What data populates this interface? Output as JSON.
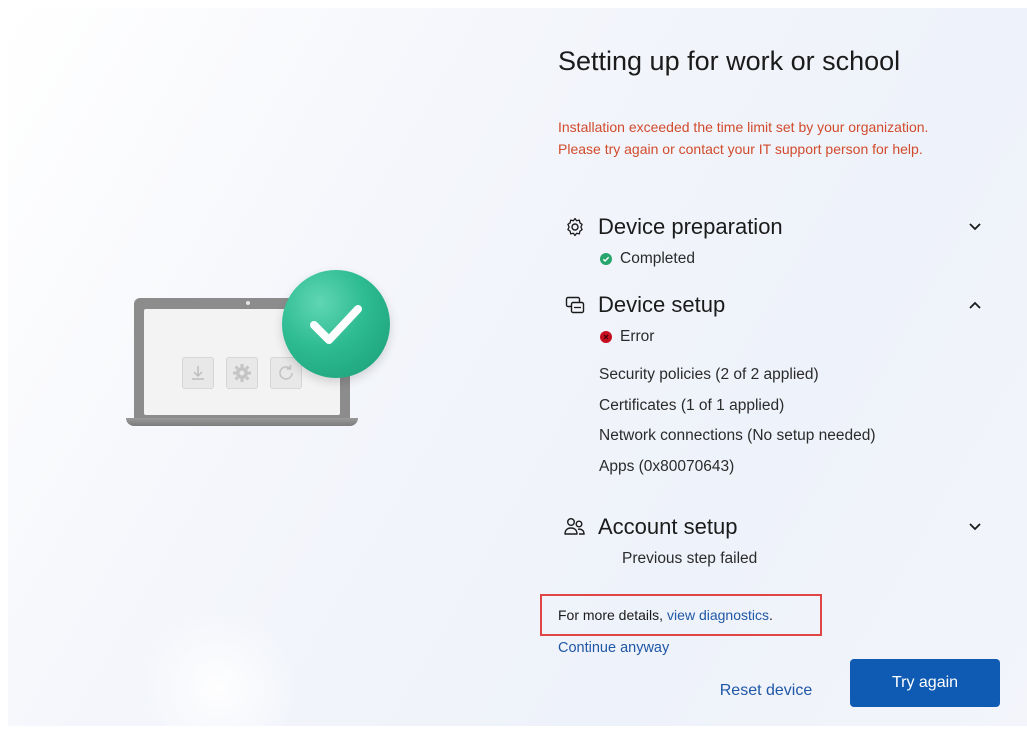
{
  "page": {
    "title": "Setting up for work or school",
    "error_message_line1": "Installation exceeded the time limit set by your organization.",
    "error_message_line2": "Please try again or contact your IT support person for help."
  },
  "sections": [
    {
      "title": "Device preparation",
      "status": "Completed",
      "status_type": "success",
      "icon": "gear-icon",
      "expanded": false
    },
    {
      "title": "Device setup",
      "status": "Error",
      "status_type": "error",
      "icon": "device-setup-icon",
      "expanded": true,
      "substeps": [
        "Security policies (2 of 2 applied)",
        "Certificates (1 of 1 applied)",
        "Network connections (No setup needed)",
        "Apps (0x80070643)"
      ]
    },
    {
      "title": "Account setup",
      "status": "Previous step failed",
      "status_type": "none",
      "icon": "people-icon",
      "expanded": false
    }
  ],
  "details": {
    "prefix": "For more details, ",
    "link": "view diagnostics",
    "suffix": "."
  },
  "actions": {
    "continue_label": "Continue anyway",
    "reset_label": "Reset device",
    "try_again_label": "Try again"
  },
  "colors": {
    "error_text": "#d14b2c",
    "link": "#1f57a6",
    "primary_button": "#0f5ab3",
    "success_badge": "#2dbb91",
    "highlight_box": "#e04545"
  }
}
